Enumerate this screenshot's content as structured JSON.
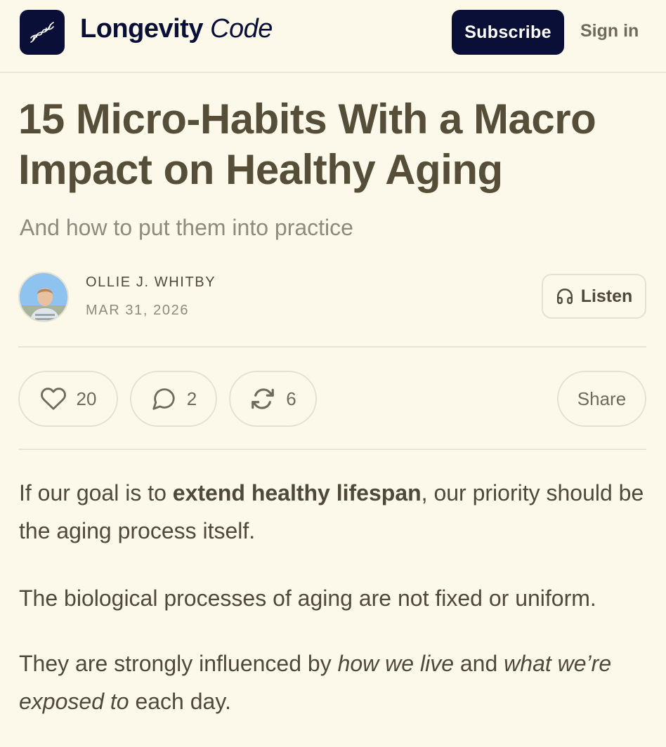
{
  "header": {
    "brand_bold": "Longevity",
    "brand_italic": "Code",
    "subscribe_label": "Subscribe",
    "signin_label": "Sign in"
  },
  "article": {
    "title": "15 Micro-Habits With a Macro Impact on Healthy Aging",
    "subtitle": "And how to put them into practice",
    "author": "OLLIE J. WHITBY",
    "date": "MAR 31, 2026",
    "listen_label": "Listen"
  },
  "actions": {
    "likes": "20",
    "comments": "2",
    "restacks": "6",
    "share_label": "Share"
  },
  "body": {
    "p1_a": "If our goal is to ",
    "p1_b": "extend healthy lifespan",
    "p1_c": ", our priority should be the aging process itself.",
    "p2": "The biological processes of aging are not fixed or uniform.",
    "p3_a": "They are strongly influenced by ",
    "p3_b": "how we live",
    "p3_c": " and ",
    "p3_d": "what we’re exposed to",
    "p3_e": " each day."
  },
  "colors": {
    "background": "#fdf9ea",
    "brand_navy": "#0a0f37",
    "text": "#4f4939"
  },
  "icons": [
    "dna-icon",
    "headphones-icon",
    "heart-icon",
    "comment-icon",
    "restack-icon"
  ]
}
